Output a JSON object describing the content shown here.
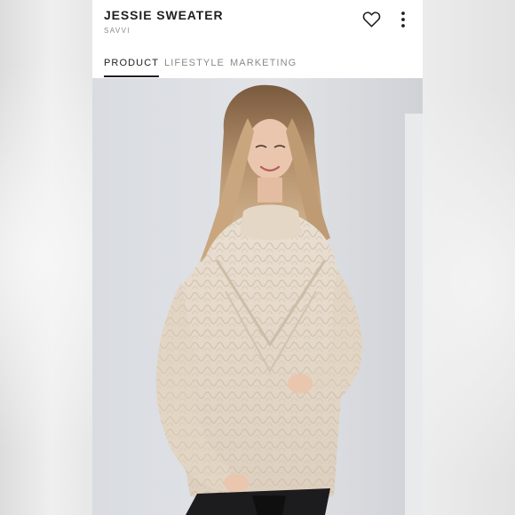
{
  "product": {
    "title": "JESSIE SWEATER",
    "brand": "SAVVI"
  },
  "actions": {
    "favorite_icon": "heart-icon",
    "more_icon": "more-vertical-icon"
  },
  "tabs": [
    {
      "label": "PRODUCT",
      "active": true
    },
    {
      "label": "LIFESTYLE",
      "active": false
    },
    {
      "label": "MARKETING",
      "active": false
    }
  ],
  "colors": {
    "text_primary": "#1f1f1f",
    "text_muted": "#8a8a8a",
    "sweater": "#e6d9c9",
    "background_wall": "#dcdfe3"
  }
}
